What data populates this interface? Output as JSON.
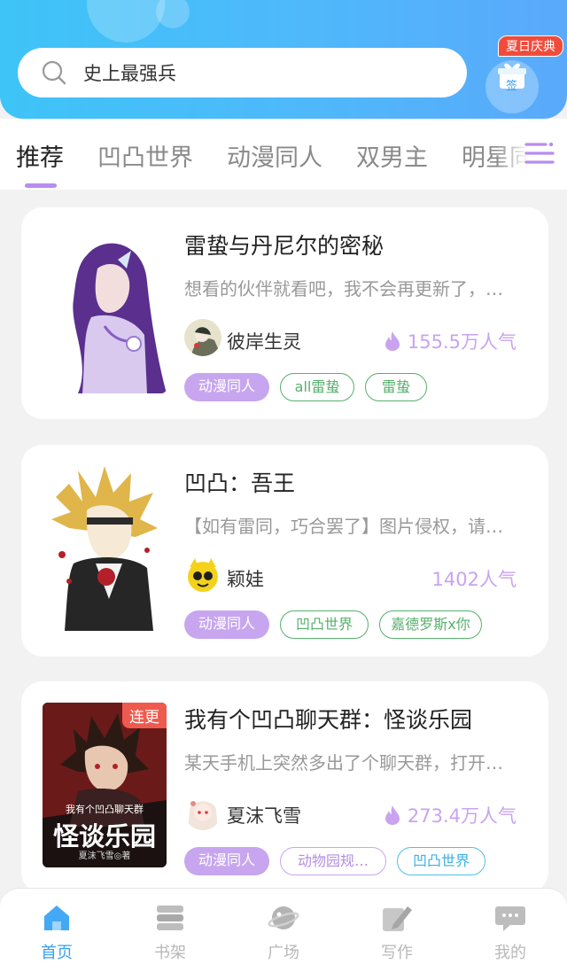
{
  "header": {
    "search_text": "史上最强兵",
    "sign_badge": "夏日庆典",
    "sign_label": "签"
  },
  "tabs": [
    {
      "label": "推荐",
      "active": true
    },
    {
      "label": "凹凸世界",
      "active": false
    },
    {
      "label": "动漫同人",
      "active": false
    },
    {
      "label": "双男主",
      "active": false
    },
    {
      "label": "明星同",
      "active": false
    }
  ],
  "books": [
    {
      "title": "雷蛰与丹尼尔的密秘",
      "desc": "想看的伙伴就看吧，我不会再更新了，…",
      "author": "彼岸生灵",
      "popularity": "155.5万人气",
      "hot": true,
      "serial": "",
      "tags": [
        "动漫同人",
        "all雷蛰",
        "雷蛰"
      ]
    },
    {
      "title": "凹凸：吾王",
      "desc": "【如有雷同，巧合罢了】图片侵权，请…",
      "author": "颖娃",
      "popularity": "1402人气",
      "hot": false,
      "serial": "",
      "tags": [
        "动漫同人",
        "凹凸世界",
        "嘉德罗斯x你"
      ]
    },
    {
      "title": "我有个凹凸聊天群：怪谈乐园",
      "desc": "某天手机上突然多出了个聊天群，打开…",
      "author": "夏沫飞雪",
      "popularity": "273.4万人气",
      "hot": true,
      "serial": "连更",
      "cover_text": "我有个凹凸聊天群",
      "cover_big": "怪谈乐园",
      "cover_small": "夏沫飞雪◎著",
      "tags": [
        "动漫同人",
        "动物园规…",
        "凹凸世界"
      ]
    }
  ],
  "bottom_nav": [
    {
      "label": "首页",
      "icon": "home-icon",
      "active": true
    },
    {
      "label": "书架",
      "icon": "bookshelf-icon",
      "active": false
    },
    {
      "label": "广场",
      "icon": "planet-icon",
      "active": false
    },
    {
      "label": "写作",
      "icon": "pen-icon",
      "active": false
    },
    {
      "label": "我的",
      "icon": "chat-bubble-icon",
      "active": false
    }
  ],
  "colors": {
    "accent_blue": "#3aa0f3",
    "accent_purple": "#c7a6ef",
    "tag_green": "#56b06c",
    "serial_red": "#ef5a4e"
  }
}
